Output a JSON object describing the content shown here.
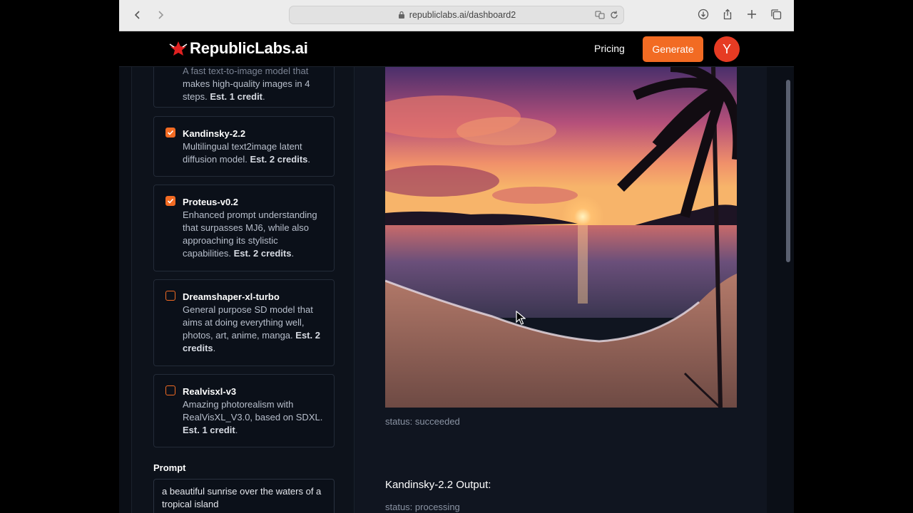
{
  "browser": {
    "url": "republiclabs.ai/dashboard2"
  },
  "header": {
    "logo_text": "RepublicLabs.ai",
    "pricing_label": "Pricing",
    "generate_label": "Generate",
    "avatar_letter": "Y"
  },
  "models": [
    {
      "name": "",
      "desc_partial": "A fast text-to-image model that",
      "desc": "makes high-quality images in 4 steps.",
      "credits": "Est. 1 credit",
      "checked": false
    },
    {
      "name": "Kandinsky-2.2",
      "desc": "Multilingual text2image latent diffusion model.",
      "credits": "Est. 2 credits",
      "checked": true
    },
    {
      "name": "Proteus-v0.2",
      "desc": "Enhanced prompt understanding that surpasses MJ6, while also approaching its stylistic capabilities.",
      "credits": "Est. 2 credits",
      "checked": true
    },
    {
      "name": "Dreamshaper-xl-turbo",
      "desc": "General purpose SD model that aims at doing everything well, photos, art, anime, manga.",
      "credits": "Est. 2 credits",
      "checked": false
    },
    {
      "name": "Realvisxl-v3",
      "desc": "Amazing photorealism with RealVisXL_V3.0, based on SDXL.",
      "credits": "Est. 1 credit",
      "checked": false
    }
  ],
  "prompt": {
    "label": "Prompt",
    "value": "a beautiful sunrise over the waters of a tropical island"
  },
  "output": {
    "status_first": "status: succeeded",
    "second_title": "Kandinsky-2.2 Output:",
    "status_second": "status: processing"
  },
  "colors": {
    "accent": "#f26b23",
    "avatar": "#e63b23"
  }
}
